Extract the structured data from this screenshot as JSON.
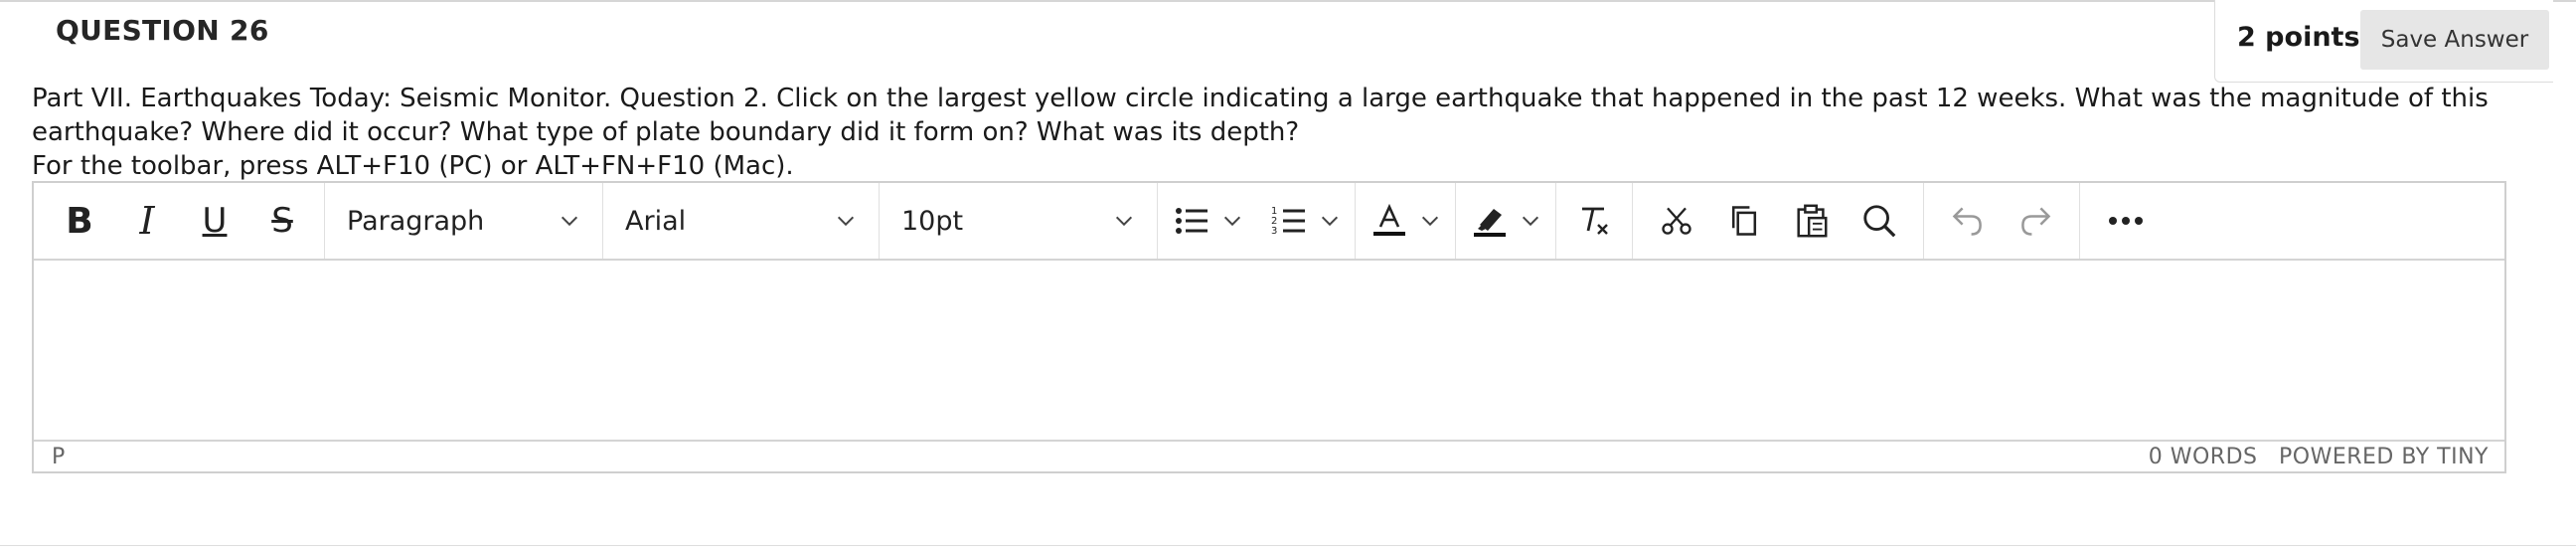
{
  "question": {
    "title": "QUESTION 26",
    "points": "2 points",
    "save_label": "Save Answer",
    "text": "Part VII. Earthquakes Today: Seismic Monitor. Question 2. Click on the largest yellow circle indicating a large earthquake that happened in the past 12 weeks. What was the magnitude of this earthquake? Where did it occur? What type of plate boundary did it form on? What was its depth?",
    "toolbar_hint": "For the toolbar, press ALT+F10 (PC) or ALT+FN+F10 (Mac)."
  },
  "toolbar": {
    "bold": "B",
    "italic": "I",
    "underline": "U",
    "strike": "S",
    "block_format": "Paragraph",
    "font_family": "Arial",
    "font_size": "10pt"
  },
  "status": {
    "path": "P",
    "word_count": "0 WORDS",
    "powered_by": "POWERED BY TINY"
  },
  "colors": {
    "accent": "#222222",
    "border": "#cfcfcf",
    "button_bg": "#e6e6e6"
  }
}
